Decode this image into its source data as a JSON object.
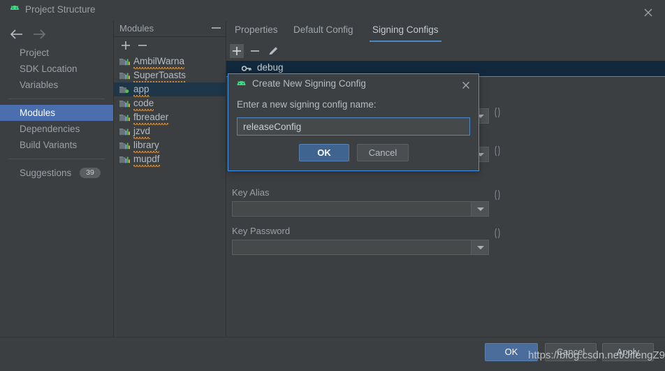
{
  "window": {
    "title": "Project Structure",
    "icon": "android-icon",
    "close_label": "close-icon"
  },
  "nav": {
    "back_icon": "arrow-left-icon",
    "forward_icon": "arrow-right-icon",
    "items": [
      {
        "label": "Project",
        "selected": false
      },
      {
        "label": "SDK Location",
        "selected": false
      },
      {
        "label": "Variables",
        "selected": false
      },
      {
        "label": "Modules",
        "selected": true
      },
      {
        "label": "Dependencies",
        "selected": false
      },
      {
        "label": "Build Variants",
        "selected": false
      }
    ],
    "suggestions": {
      "label": "Suggestions",
      "count": "39"
    }
  },
  "modules_panel": {
    "header": "Modules",
    "collapse_icon": "minimize-icon",
    "add_icon": "plus-icon",
    "remove_icon": "minus-icon",
    "items": [
      {
        "label": "AmbilWarna",
        "selected": false,
        "is_app": false
      },
      {
        "label": "SuperToasts",
        "selected": false,
        "is_app": false
      },
      {
        "label": "app",
        "selected": true,
        "is_app": true
      },
      {
        "label": "code",
        "selected": false,
        "is_app": false
      },
      {
        "label": "fbreader",
        "selected": false,
        "is_app": false
      },
      {
        "label": "jzvd",
        "selected": false,
        "is_app": false
      },
      {
        "label": "library",
        "selected": false,
        "is_app": false
      },
      {
        "label": "mupdf",
        "selected": false,
        "is_app": false
      }
    ]
  },
  "content": {
    "tabs": [
      {
        "label": "Properties",
        "active": false
      },
      {
        "label": "Default Config",
        "active": false
      },
      {
        "label": "Signing Configs",
        "active": true
      }
    ],
    "toolbar": {
      "add_icon": "plus-icon",
      "remove_icon": "minus-icon",
      "edit_icon": "pencil-icon"
    },
    "signing_config_row": {
      "label": "debug",
      "icon": "key-icon"
    },
    "fields": [
      {
        "label": "",
        "value": "",
        "dropdown_icon": "chevron-down-icon",
        "var_icon": "variable-icon"
      },
      {
        "label": "",
        "value": "",
        "dropdown_icon": "chevron-down-icon",
        "var_icon": "variable-icon"
      },
      {
        "label": "Key Alias",
        "value": "",
        "dropdown_icon": "chevron-down-icon",
        "var_icon": "variable-icon"
      },
      {
        "label": "Key Password",
        "value": "",
        "dropdown_icon": "chevron-down-icon",
        "var_icon": "variable-icon"
      }
    ]
  },
  "footer": {
    "ok": "OK",
    "cancel": "Cancel",
    "apply": "Apply"
  },
  "dialog": {
    "icon": "android-icon",
    "title": "Create New Signing Config",
    "close_icon": "close-icon",
    "prompt": "Enter a new signing config name:",
    "input_value": "releaseConfig",
    "input_placeholder": "",
    "ok": "OK",
    "cancel": "Cancel"
  },
  "watermark": {
    "text": "https://blog.csdn.net/JifengZ9"
  },
  "colors": {
    "background": "#3c3f41",
    "selection_blue": "#4b6eaf",
    "accent_blue": "#4a88c7",
    "dialog_border": "#3d93f0",
    "row_selected_dark": "#12293d",
    "module_selected": "#1f3548",
    "android_green": "#3ddc84",
    "squiggly_orange": "#d38c3a"
  }
}
